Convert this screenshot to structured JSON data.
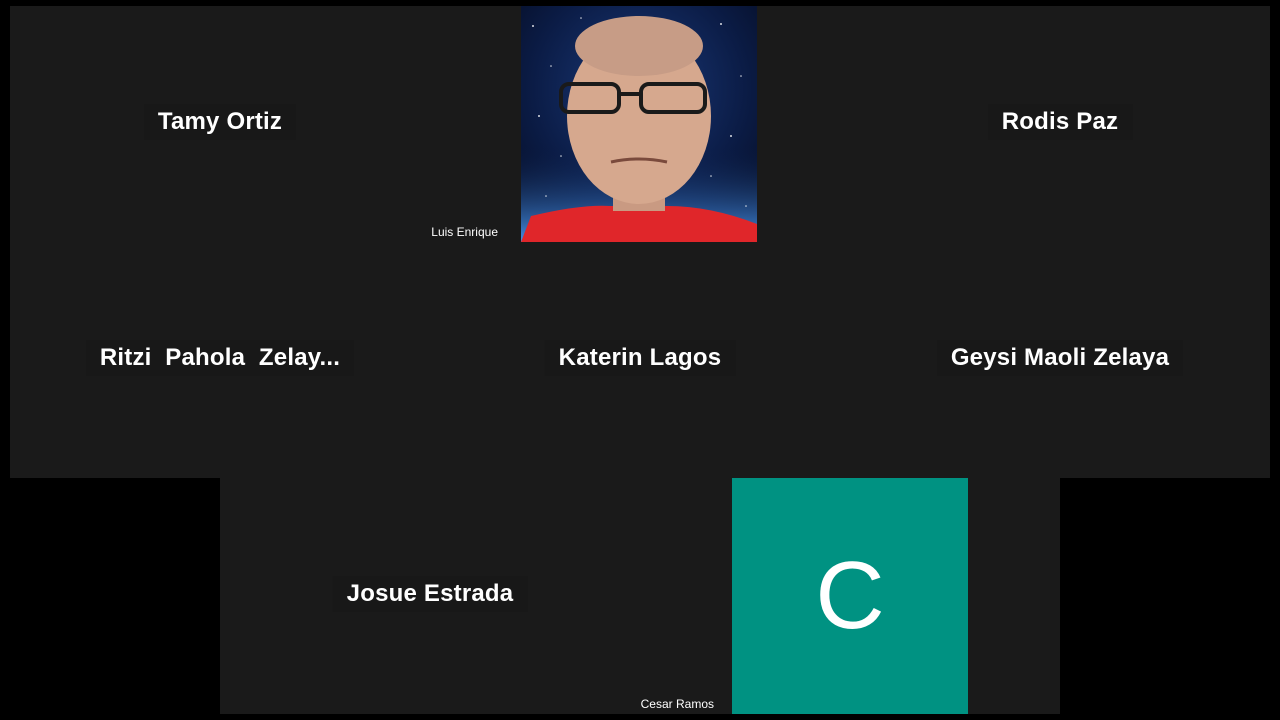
{
  "meeting": {
    "participants": [
      {
        "name": "Tamy Ortiz"
      },
      {
        "name": "Luis Enrique"
      },
      {
        "name": "Rodis Paz"
      },
      {
        "name": "Ritzi  Pahola  Zelay..."
      },
      {
        "name": "Katerin Lagos"
      },
      {
        "name": "Geysi Maoli Zelaya"
      },
      {
        "name": "Josue Estrada"
      },
      {
        "name": "Cesar Ramos",
        "avatar_letter": "C",
        "avatar_color": "#009282"
      }
    ]
  },
  "colors": {
    "background": "#000000",
    "tile": "#1a1a1a",
    "avatar": "#009282"
  }
}
